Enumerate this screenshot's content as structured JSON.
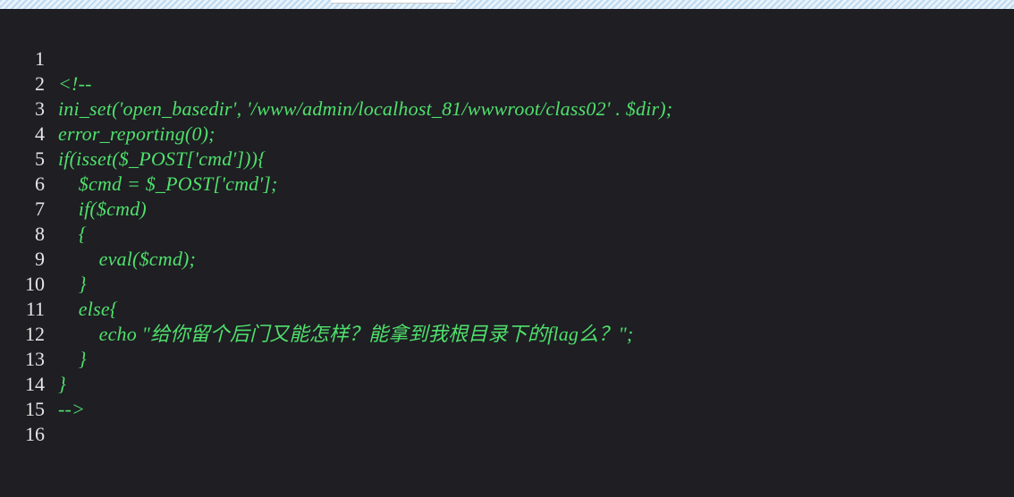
{
  "editor": {
    "lines": [
      {
        "num": "1",
        "text": "<!--"
      },
      {
        "num": "2",
        "text": "ini_set('open_basedir', '/www/admin/localhost_81/wwwroot/class02' . $dir);"
      },
      {
        "num": "3",
        "text": "error_reporting(0);"
      },
      {
        "num": "4",
        "text": "if(isset($_POST['cmd'])){"
      },
      {
        "num": "5",
        "text": "    $cmd = $_POST['cmd'];"
      },
      {
        "num": "6",
        "text": "    if($cmd)"
      },
      {
        "num": "7",
        "text": "    {"
      },
      {
        "num": "8",
        "text": "        eval($cmd);"
      },
      {
        "num": "9",
        "text": "    }"
      },
      {
        "num": "10",
        "text": "    else{"
      },
      {
        "num": "11",
        "text": "        echo \"给你留个后门又能怎样？能拿到我根目录下的flag么？\";"
      },
      {
        "num": "12",
        "text": "    }"
      },
      {
        "num": "13",
        "text": "}"
      },
      {
        "num": "14",
        "text": "-->"
      },
      {
        "num": "15",
        "text": ""
      },
      {
        "num": "16",
        "text": ""
      }
    ]
  },
  "colors": {
    "background": "#1e1e23",
    "code_text": "#4fe06b",
    "line_numbers": "#e6e6e6"
  }
}
